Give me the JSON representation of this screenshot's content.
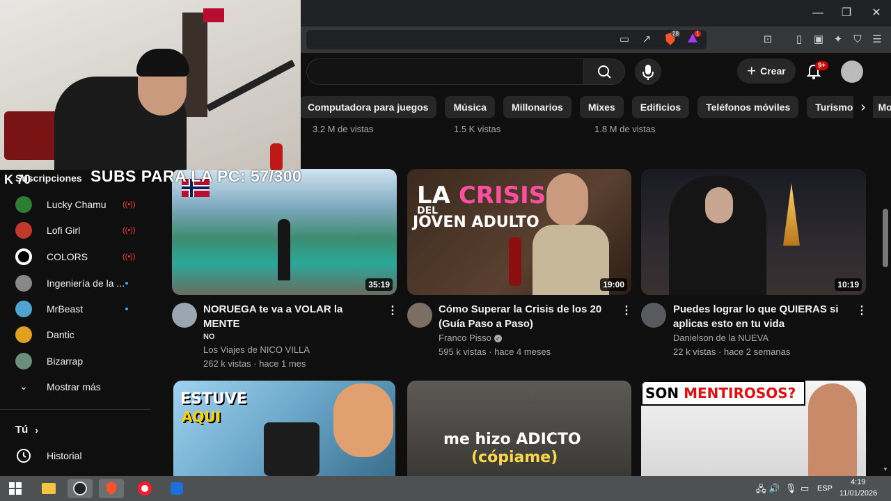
{
  "browser": {
    "shield_badge": "28",
    "alert_badge": "1"
  },
  "header": {
    "create_label": "Crear",
    "notifications_badge": "9+"
  },
  "chips": [
    "Computadora para juegos",
    "Música",
    "Millonarios",
    "Mixes",
    "Edificios",
    "Teléfonos móviles",
    "Turismo",
    "Motivació"
  ],
  "previous_row_views": [
    "3.2 M de vistas",
    "1.5 K vistas",
    "1.8 M de vistas"
  ],
  "overlay": {
    "subs_banner": "SUBS PARA LA PC: 57/300",
    "logo_text": "K 70"
  },
  "sidebar": {
    "title": "Suscripciones",
    "items": [
      {
        "label": "Lucky Chamu",
        "indicator": "live",
        "color": "#2e7d32"
      },
      {
        "label": "Lofi Girl",
        "indicator": "live",
        "color": "#c0392b"
      },
      {
        "label": "COLORS",
        "indicator": "live",
        "color": "#ffffff"
      },
      {
        "label": "Ingeniería de la ...",
        "indicator": "new",
        "color": "#888888"
      },
      {
        "label": "MrBeast",
        "indicator": "new",
        "color": "#4fa3d1"
      },
      {
        "label": "Dantic",
        "indicator": "",
        "color": "#e0a020"
      },
      {
        "label": "Bizarrap",
        "indicator": "",
        "color": "#6b8e7a"
      }
    ],
    "show_more": "Mostrar más",
    "you_label": "Tú",
    "history_label": "Historial"
  },
  "videos": [
    {
      "title_line1": "NORUEGA te va a VOLAR la MENTE",
      "title_line2": "",
      "badge": "NO",
      "channel": "Los Viajes de NICO VILLA",
      "views": "262 k vistas · hace 1 mes",
      "duration": "35:19",
      "verified": false
    },
    {
      "title_line1": "Cómo Superar la Crisis de los 20",
      "title_line2": "(Guía Paso a Paso)",
      "badge": "",
      "channel": "Franco Pisso",
      "views": "595 k vistas · hace 4 meses",
      "duration": "19:00",
      "verified": true,
      "thumb_text1": "LA CRISIS",
      "thumb_text2": "DEL",
      "thumb_text3": "JOVEN ADULTO"
    },
    {
      "title_line1": "Puedes lograr lo que QUIERAS si",
      "title_line2": "aplicas esto en tu vida",
      "badge": "",
      "channel": "Danielson de la NUEVA",
      "views": "22 k vistas · hace 2 semanas",
      "duration": "10:19",
      "verified": false
    }
  ],
  "row2_thumbs": {
    "t1_text1": "ESTUVE",
    "t1_text2": "AQUI",
    "t2_text1": "me hizo ADICTO",
    "t2_text2": "(cópiame)",
    "t3_text1": "SON ",
    "t3_text2": "MENTIROSOS?"
  },
  "taskbar": {
    "lang": "ESP",
    "time": "4:19",
    "date": "11/01/2026"
  }
}
